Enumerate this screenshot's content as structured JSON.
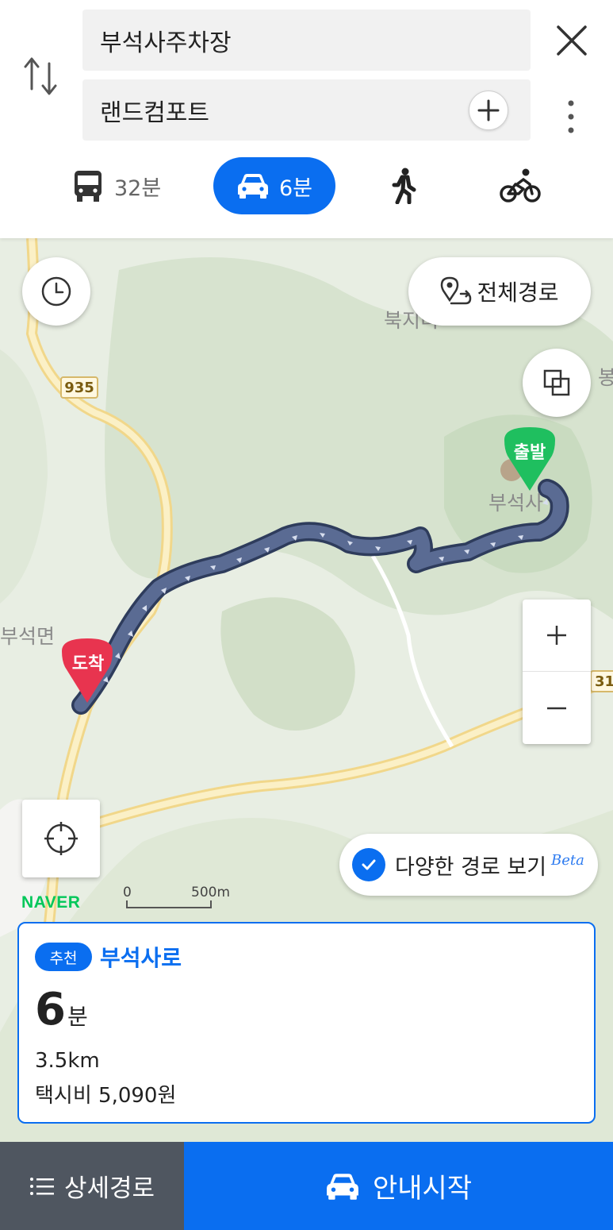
{
  "header": {
    "origin": "부석사주차장",
    "destination": "랜드컴포트",
    "modes": [
      {
        "name": "bus",
        "label": "32분",
        "selected": false
      },
      {
        "name": "car",
        "label": "6분",
        "selected": true
      },
      {
        "name": "walk",
        "label": "",
        "selected": false
      },
      {
        "name": "bike",
        "label": "",
        "selected": false
      }
    ]
  },
  "map": {
    "full_route_label": "전체경로",
    "place_labels": [
      "북지리",
      "부석사",
      "부석면",
      "봉"
    ],
    "road_numbers": [
      "935",
      "31"
    ],
    "start_pin": "출발",
    "end_pin": "도착",
    "logo": "NAVER",
    "scale": {
      "zero": "0",
      "distance": "500m"
    },
    "variety_label": "다양한 경로 보기",
    "beta_label": "Beta"
  },
  "route_card": {
    "badge": "추천",
    "name": "부석사로",
    "duration_value": "6",
    "duration_unit": "분",
    "distance": "3.5km",
    "taxi_fare": "택시비 5,090원"
  },
  "bottom": {
    "detail_label": "상세경로",
    "start_label": "안내시작"
  },
  "colors": {
    "accent": "#0a6ef0",
    "route": "#4a5a80",
    "start_pin": "#1fbf5f",
    "end_pin": "#e8344f",
    "detail_bg": "#4f5660"
  }
}
